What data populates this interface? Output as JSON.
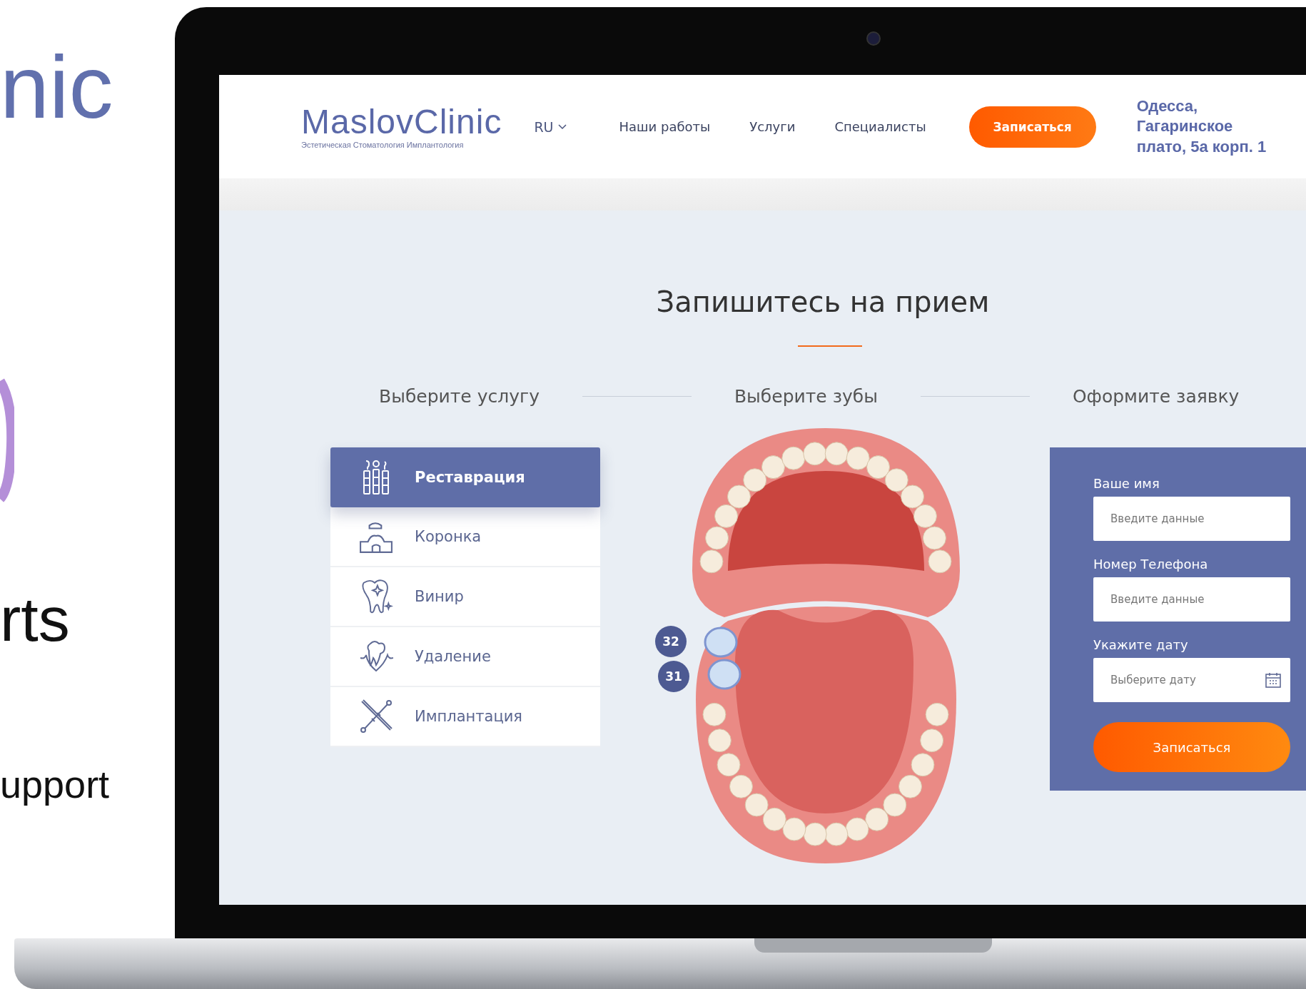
{
  "backdrop": {
    "headline": "nic",
    "feature": "rts",
    "tagline": "upport"
  },
  "header": {
    "logo": "MaslovClinic",
    "logo_tagline": "Эстетическая Стоматология Имплантология",
    "language": "RU",
    "nav": [
      "Наши работы",
      "Услуги",
      "Специалисты"
    ],
    "cta": "Записаться",
    "address": "Одесса,\nГагаринское\nплато, 5а корп. 1"
  },
  "booking": {
    "title": "Запишитесь на прием",
    "steps": [
      "Выберите услугу",
      "Выберите зубы",
      "Оформите заявку"
    ],
    "services": [
      {
        "label": "Реставрация",
        "kind": "instruments",
        "selected": true
      },
      {
        "label": "Коронка",
        "kind": "crown",
        "selected": false
      },
      {
        "label": "Винир",
        "kind": "veneer",
        "selected": false
      },
      {
        "label": "Удаление",
        "kind": "extraction",
        "selected": false
      },
      {
        "label": "Имплантация",
        "kind": "implant",
        "selected": false
      }
    ],
    "teeth_badges": [
      "32",
      "31"
    ],
    "form": {
      "fields": [
        {
          "label": "Ваше имя",
          "placeholder": "Введите данные",
          "kind": "text"
        },
        {
          "label": "Номер Телефона",
          "placeholder": "Введите данные",
          "kind": "text"
        },
        {
          "label": "Укажите дату",
          "placeholder": "Выберите дату",
          "kind": "date"
        }
      ],
      "submit": "Записаться"
    }
  }
}
